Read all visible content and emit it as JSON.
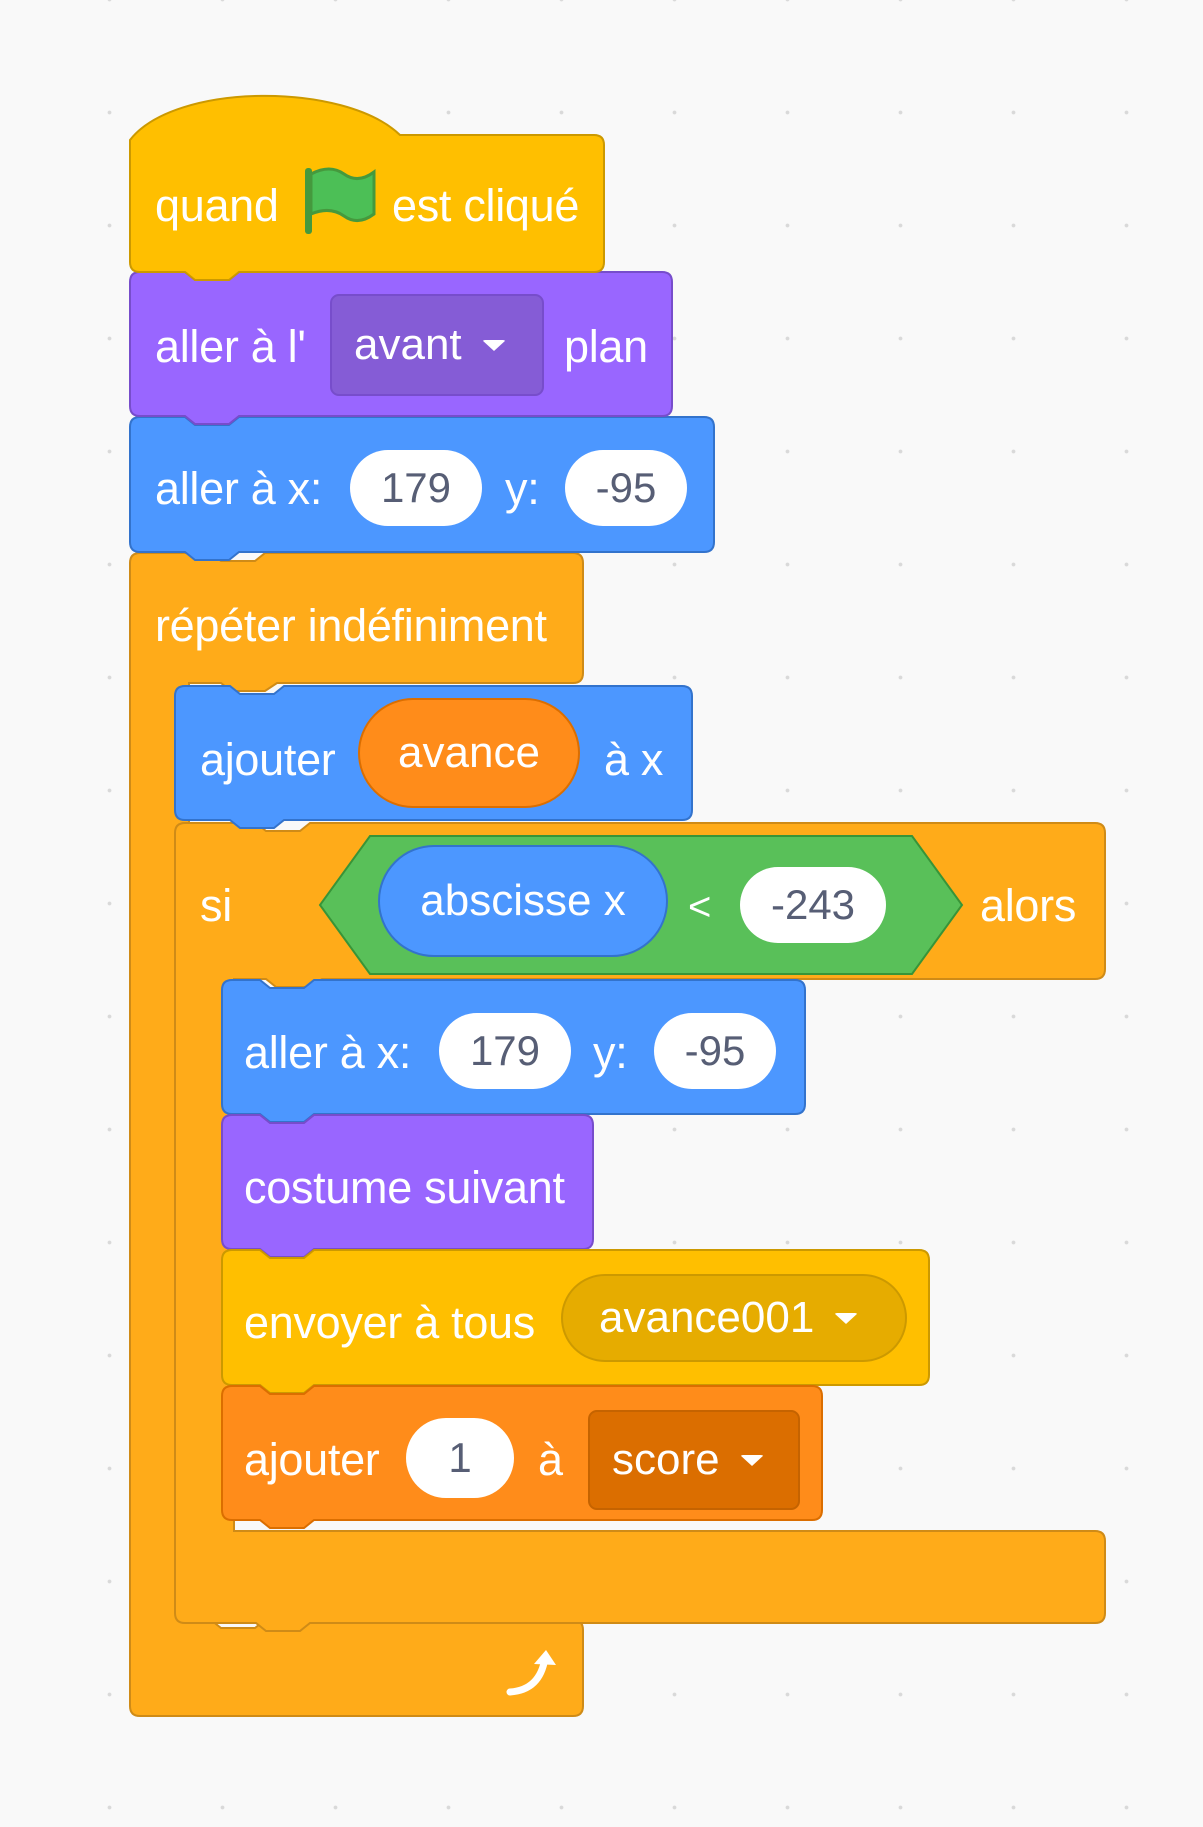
{
  "script": {
    "hat_block": {
      "before_label": "quand",
      "after_label": "est cliqué",
      "icon": "green-flag-icon"
    },
    "goto_layer_block": {
      "prefix": "aller à l'",
      "option": "avant",
      "suffix": "plan"
    },
    "goto_xy_block": {
      "x_label": "aller à x:",
      "x_value": "179",
      "y_label": "y:",
      "y_value": "-95"
    },
    "forever_block": {
      "label": "répéter indéfiniment",
      "loop_icon": "loop-arrow-icon"
    },
    "change_x_block": {
      "prefix": "ajouter",
      "variable": "avance",
      "suffix": "à x"
    },
    "if_block": {
      "if_label": "si",
      "reporter": "abscisse x",
      "operator": "<",
      "compare_value": "-243",
      "then_label": "alors"
    },
    "inner_goto_xy_block": {
      "x_label": "aller à x:",
      "x_value": "179",
      "y_label": "y:",
      "y_value": "-95"
    },
    "next_costume_block": {
      "label": "costume suivant"
    },
    "broadcast_block": {
      "label": "envoyer à tous",
      "message": "avance001"
    },
    "change_var_block": {
      "prefix": "ajouter",
      "value": "1",
      "middle": "à",
      "variable": "score"
    }
  },
  "colors": {
    "events": "#ffbf00",
    "looks": "#9966ff",
    "motion": "#4c97ff",
    "control": "#ffab19",
    "operators": "#59c059",
    "variables": "#ff8c1a",
    "flag": "#4cbf56"
  }
}
